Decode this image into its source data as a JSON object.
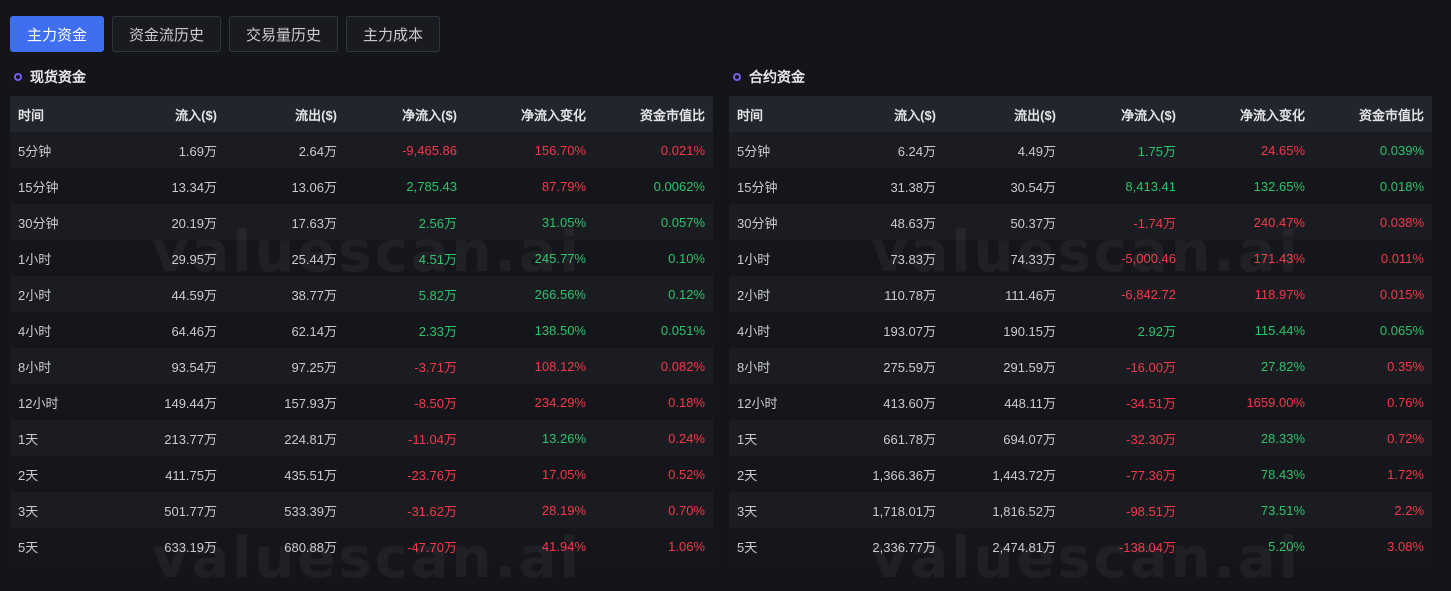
{
  "tabs": [
    {
      "label": "主力资金",
      "active": true
    },
    {
      "label": "资金流历史",
      "active": false
    },
    {
      "label": "交易量历史",
      "active": false
    },
    {
      "label": "主力成本",
      "active": false
    }
  ],
  "watermark": "valuescan.ai",
  "colors": {
    "accent": "#3f6ff0",
    "positive": "#2ec26c",
    "negative": "#f03a4a"
  },
  "spot": {
    "title": "现货资金",
    "headers": [
      "时间",
      "流入($)",
      "流出($)",
      "净流入($)",
      "净流入变化",
      "资金市值比"
    ],
    "rows": [
      {
        "cells": [
          "5分钟",
          "1.69万",
          "2.64万",
          "-9,465.86",
          "156.70%",
          "0.021%"
        ],
        "dirs": [
          "",
          "",
          "",
          "neg",
          "neg",
          "neg"
        ]
      },
      {
        "cells": [
          "15分钟",
          "13.34万",
          "13.06万",
          "2,785.43",
          "87.79%",
          "0.0062%"
        ],
        "dirs": [
          "",
          "",
          "",
          "pos",
          "neg",
          "pos"
        ]
      },
      {
        "cells": [
          "30分钟",
          "20.19万",
          "17.63万",
          "2.56万",
          "31.05%",
          "0.057%"
        ],
        "dirs": [
          "",
          "",
          "",
          "pos",
          "pos",
          "pos"
        ]
      },
      {
        "cells": [
          "1小时",
          "29.95万",
          "25.44万",
          "4.51万",
          "245.77%",
          "0.10%"
        ],
        "dirs": [
          "",
          "",
          "",
          "pos",
          "pos",
          "pos"
        ]
      },
      {
        "cells": [
          "2小时",
          "44.59万",
          "38.77万",
          "5.82万",
          "266.56%",
          "0.12%"
        ],
        "dirs": [
          "",
          "",
          "",
          "pos",
          "pos",
          "pos"
        ]
      },
      {
        "cells": [
          "4小时",
          "64.46万",
          "62.14万",
          "2.33万",
          "138.50%",
          "0.051%"
        ],
        "dirs": [
          "",
          "",
          "",
          "pos",
          "pos",
          "pos"
        ]
      },
      {
        "cells": [
          "8小时",
          "93.54万",
          "97.25万",
          "-3.71万",
          "108.12%",
          "0.082%"
        ],
        "dirs": [
          "",
          "",
          "",
          "neg",
          "neg",
          "neg"
        ]
      },
      {
        "cells": [
          "12小时",
          "149.44万",
          "157.93万",
          "-8.50万",
          "234.29%",
          "0.18%"
        ],
        "dirs": [
          "",
          "",
          "",
          "neg",
          "neg",
          "neg"
        ]
      },
      {
        "cells": [
          "1天",
          "213.77万",
          "224.81万",
          "-11.04万",
          "13.26%",
          "0.24%"
        ],
        "dirs": [
          "",
          "",
          "",
          "neg",
          "pos",
          "neg"
        ]
      },
      {
        "cells": [
          "2天",
          "411.75万",
          "435.51万",
          "-23.76万",
          "17.05%",
          "0.52%"
        ],
        "dirs": [
          "",
          "",
          "",
          "neg",
          "neg",
          "neg"
        ]
      },
      {
        "cells": [
          "3天",
          "501.77万",
          "533.39万",
          "-31.62万",
          "28.19%",
          "0.70%"
        ],
        "dirs": [
          "",
          "",
          "",
          "neg",
          "neg",
          "neg"
        ]
      },
      {
        "cells": [
          "5天",
          "633.19万",
          "680.88万",
          "-47.70万",
          "41.94%",
          "1.06%"
        ],
        "dirs": [
          "",
          "",
          "",
          "neg",
          "neg",
          "neg"
        ]
      }
    ]
  },
  "futures": {
    "title": "合约资金",
    "headers": [
      "时间",
      "流入($)",
      "流出($)",
      "净流入($)",
      "净流入变化",
      "资金市值比"
    ],
    "rows": [
      {
        "cells": [
          "5分钟",
          "6.24万",
          "4.49万",
          "1.75万",
          "24.65%",
          "0.039%"
        ],
        "dirs": [
          "",
          "",
          "",
          "pos",
          "neg",
          "pos"
        ]
      },
      {
        "cells": [
          "15分钟",
          "31.38万",
          "30.54万",
          "8,413.41",
          "132.65%",
          "0.018%"
        ],
        "dirs": [
          "",
          "",
          "",
          "pos",
          "pos",
          "pos"
        ]
      },
      {
        "cells": [
          "30分钟",
          "48.63万",
          "50.37万",
          "-1.74万",
          "240.47%",
          "0.038%"
        ],
        "dirs": [
          "",
          "",
          "",
          "neg",
          "neg",
          "neg"
        ]
      },
      {
        "cells": [
          "1小时",
          "73.83万",
          "74.33万",
          "-5,000.46",
          "171.43%",
          "0.011%"
        ],
        "dirs": [
          "",
          "",
          "",
          "neg",
          "neg",
          "neg"
        ]
      },
      {
        "cells": [
          "2小时",
          "110.78万",
          "111.46万",
          "-6,842.72",
          "118.97%",
          "0.015%"
        ],
        "dirs": [
          "",
          "",
          "",
          "neg",
          "neg",
          "neg"
        ]
      },
      {
        "cells": [
          "4小时",
          "193.07万",
          "190.15万",
          "2.92万",
          "115.44%",
          "0.065%"
        ],
        "dirs": [
          "",
          "",
          "",
          "pos",
          "pos",
          "pos"
        ]
      },
      {
        "cells": [
          "8小时",
          "275.59万",
          "291.59万",
          "-16.00万",
          "27.82%",
          "0.35%"
        ],
        "dirs": [
          "",
          "",
          "",
          "neg",
          "pos",
          "neg"
        ]
      },
      {
        "cells": [
          "12小时",
          "413.60万",
          "448.11万",
          "-34.51万",
          "1659.00%",
          "0.76%"
        ],
        "dirs": [
          "",
          "",
          "",
          "neg",
          "neg",
          "neg"
        ]
      },
      {
        "cells": [
          "1天",
          "661.78万",
          "694.07万",
          "-32.30万",
          "28.33%",
          "0.72%"
        ],
        "dirs": [
          "",
          "",
          "",
          "neg",
          "pos",
          "neg"
        ]
      },
      {
        "cells": [
          "2天",
          "1,366.36万",
          "1,443.72万",
          "-77.36万",
          "78.43%",
          "1.72%"
        ],
        "dirs": [
          "",
          "",
          "",
          "neg",
          "pos",
          "neg"
        ]
      },
      {
        "cells": [
          "3天",
          "1,718.01万",
          "1,816.52万",
          "-98.51万",
          "73.51%",
          "2.2%"
        ],
        "dirs": [
          "",
          "",
          "",
          "neg",
          "pos",
          "neg"
        ]
      },
      {
        "cells": [
          "5天",
          "2,336.77万",
          "2,474.81万",
          "-138.04万",
          "5.20%",
          "3.08%"
        ],
        "dirs": [
          "",
          "",
          "",
          "neg",
          "pos",
          "neg"
        ]
      }
    ]
  }
}
